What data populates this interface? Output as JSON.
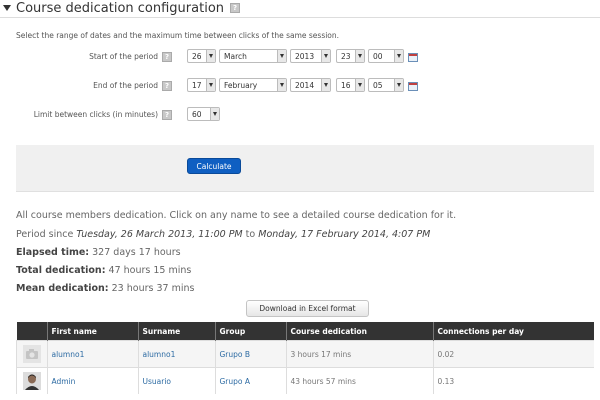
{
  "legend": {
    "title": "Course dedication configuration",
    "help": "?"
  },
  "instructions": "Select the range of dates and the maximum time between clicks of the same session.",
  "form": {
    "start": {
      "label": "Start of the period",
      "day": "26",
      "month": "March",
      "year": "2013",
      "hour": "23",
      "minute": "00"
    },
    "end": {
      "label": "End of the period",
      "day": "17",
      "month": "February",
      "year": "2014",
      "hour": "16",
      "minute": "05"
    },
    "limit": {
      "label": "Limit between clicks (in minutes)",
      "value": "60"
    },
    "calculate": "Calculate"
  },
  "summary": {
    "intro": "All course members dedication. Click on any name to see a detailed course dedication for it.",
    "period_prefix": "Period since",
    "period_start": "Tuesday, 26 March 2013, 11:00 PM",
    "period_to": "to",
    "period_end": "Monday, 17 February 2014, 4:07 PM",
    "elapsed_label": "Elapsed time:",
    "elapsed_value": "327 days 17 hours",
    "total_label": "Total dedication:",
    "total_value": "47 hours 15 mins",
    "mean_label": "Mean dedication:",
    "mean_value": "23 hours 37 mins"
  },
  "download": "Download in Excel format",
  "table": {
    "headers": [
      "",
      "First name",
      "Surname",
      "Group",
      "Course dedication",
      "Connections per day"
    ],
    "rows": [
      {
        "avatar": "default-avatar-icon",
        "first": "alumno1",
        "surname": "alumno1",
        "group": "Grupo B",
        "dedication": "3 hours 17 mins",
        "connections": "0.02"
      },
      {
        "avatar": "user-photo",
        "first": "Admin",
        "surname": "Usuario",
        "group": "Grupo A",
        "dedication": "43 hours 57 mins",
        "connections": "0.13"
      }
    ]
  },
  "colors": {
    "primary_button": "#0f5fc2",
    "link": "#2d6ba3",
    "table_header": "#333333"
  }
}
